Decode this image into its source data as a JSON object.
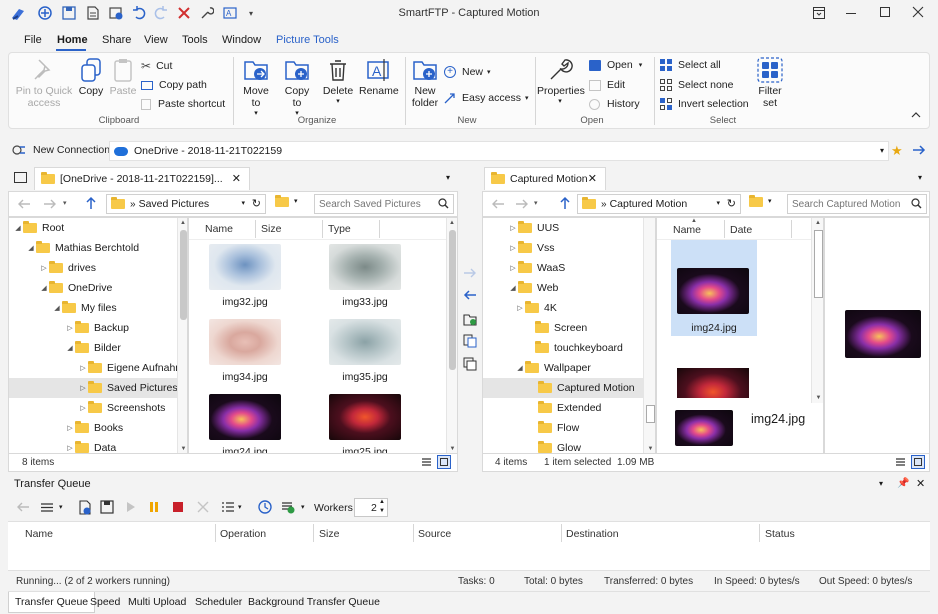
{
  "window": {
    "title": "SmartFTP - Captured Motion"
  },
  "menu": {
    "file": "File",
    "home": "Home",
    "share": "Share",
    "view": "View",
    "tools": "Tools",
    "window": "Window",
    "picture_tools": "Picture Tools"
  },
  "ribbon": {
    "clipboard": {
      "pin": "Pin to Quick access",
      "copy": "Copy",
      "paste": "Paste",
      "cut": "Cut",
      "copy_path": "Copy path",
      "paste_shortcut": "Paste shortcut",
      "group": "Clipboard"
    },
    "organize": {
      "move_to": "Move to",
      "copy_to": "Copy to",
      "delete": "Delete",
      "rename": "Rename",
      "group": "Organize"
    },
    "new": {
      "new_folder": "New folder",
      "new_item": "New",
      "easy_access": "Easy access",
      "group": "New"
    },
    "open": {
      "properties": "Properties",
      "open": "Open",
      "edit": "Edit",
      "history": "History",
      "group": "Open"
    },
    "select": {
      "select_all": "Select all",
      "select_none": "Select none",
      "invert": "Invert selection",
      "filter_set": "Filter set",
      "group": "Select"
    }
  },
  "connbar": {
    "new_connection": "New Connection",
    "location": "OneDrive - 2018-11-21T022159"
  },
  "left": {
    "tab": "[OneDrive - 2018-11-21T022159]...",
    "path": "Saved Pictures",
    "search_placeholder": "Search Saved Pictures",
    "cols": [
      "Name",
      "Size",
      "Type"
    ],
    "tree": [
      "Root",
      "Mathias Berchtold",
      "drives",
      "OneDrive",
      "My files",
      "Backup",
      "Bilder",
      "Eigene Aufnahmen",
      "Saved Pictures",
      "Screenshots",
      "Books",
      "Data"
    ],
    "files": [
      "img32.jpg",
      "img33.jpg",
      "img34.jpg",
      "img35.jpg",
      "img24.jpg",
      "img25.jpg"
    ],
    "status": "8 items"
  },
  "right": {
    "tab": "Captured Motion",
    "path": "Captured Motion",
    "search_placeholder": "Search Captured Motion",
    "cols": [
      "Name",
      "Date"
    ],
    "tree": [
      "UUS",
      "Vss",
      "WaaS",
      "Web",
      "4K",
      "Screen",
      "touchkeyboard",
      "Wallpaper",
      "Captured Motion",
      "Extended",
      "Flow",
      "Glow"
    ],
    "files": [
      "img24.jpg"
    ],
    "preview_label": "img24.jpg",
    "status_items": "4 items",
    "status_selected": "1 item selected",
    "status_size": "1.09 MB"
  },
  "queue": {
    "title": "Transfer Queue",
    "workers_label": "Workers",
    "workers_value": "2",
    "cols": [
      "Name",
      "Operation",
      "Size",
      "Source",
      "Destination",
      "Status"
    ],
    "status": {
      "running": "Running... (2 of 2 workers running)",
      "tasks": "Tasks: 0",
      "total": "Total: 0 bytes",
      "transferred": "Transferred: 0 bytes",
      "in_speed": "In Speed: 0 bytes/s",
      "out_speed": "Out Speed: 0 bytes/s"
    },
    "tabs": [
      "Transfer Queue",
      "Speed",
      "Multi Upload",
      "Scheduler",
      "Background Transfer Queue"
    ]
  }
}
